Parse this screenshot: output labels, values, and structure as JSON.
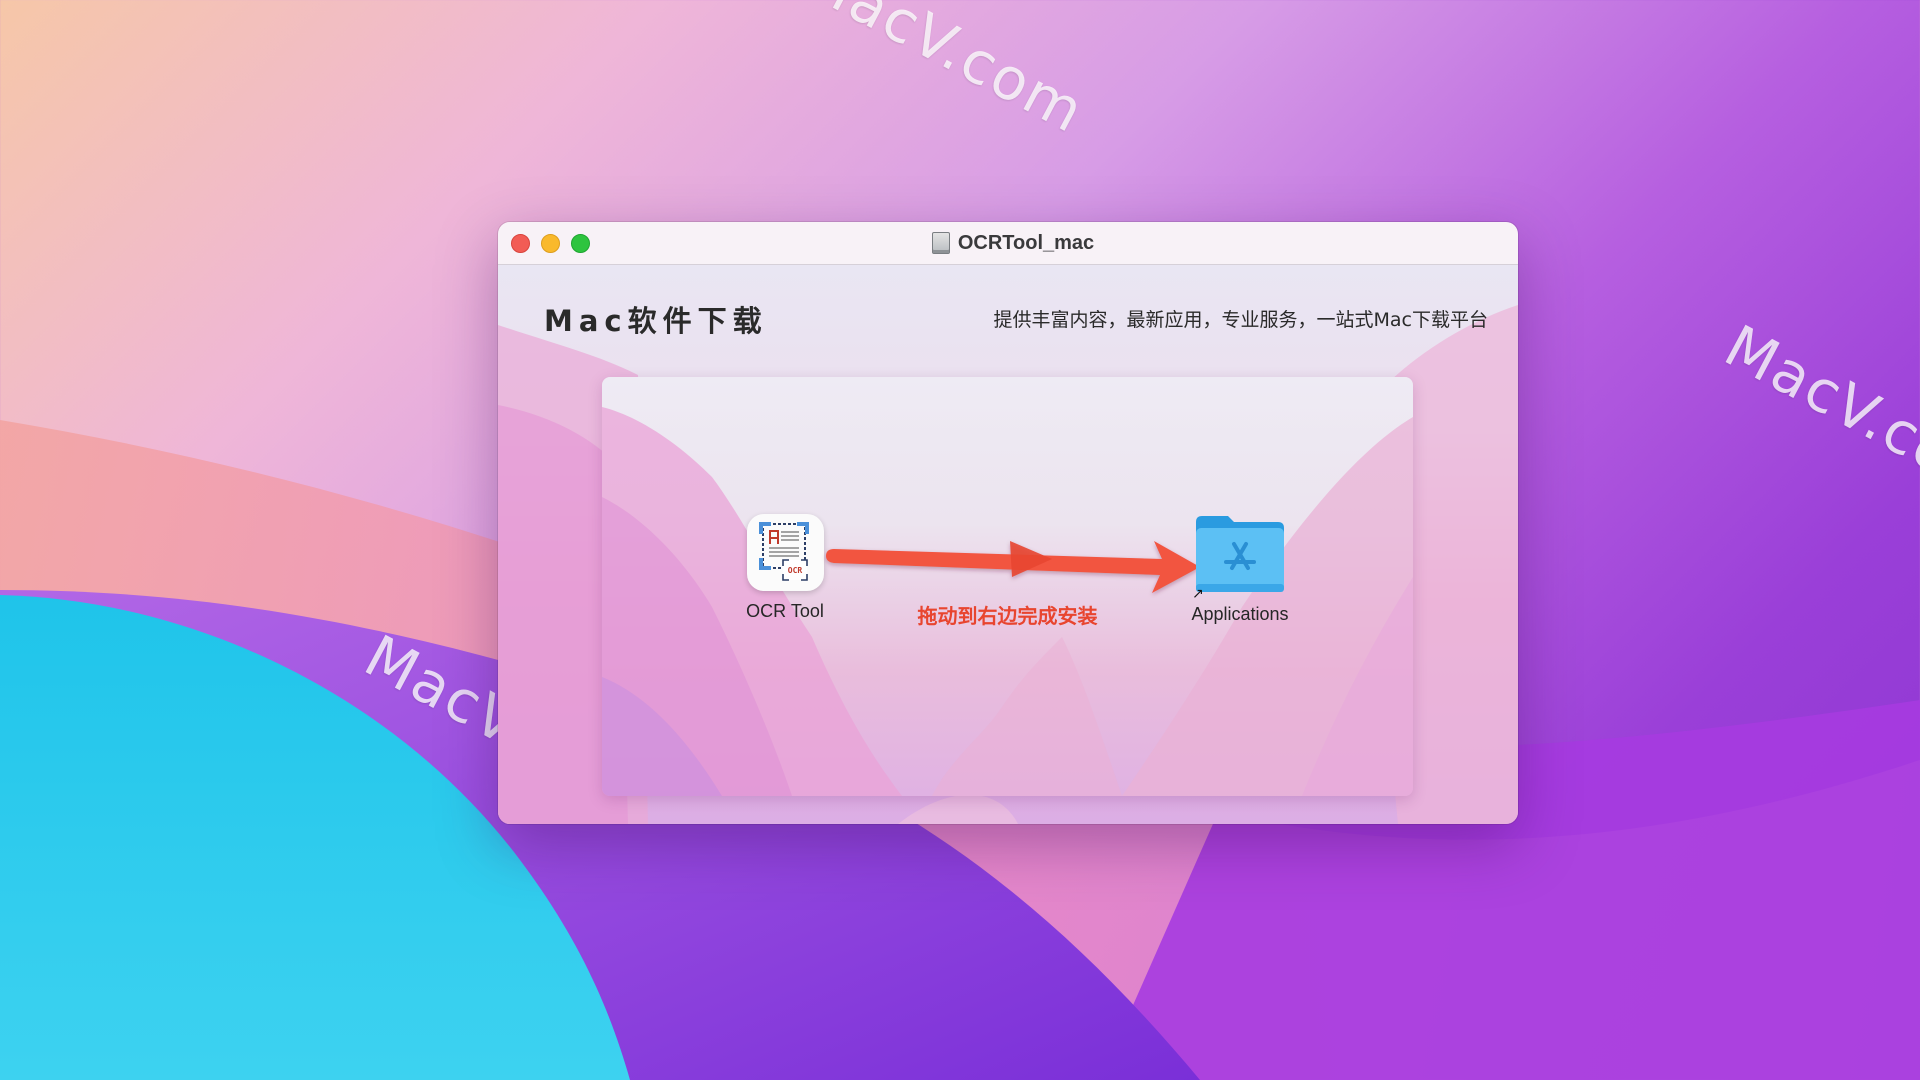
{
  "desktop": {
    "watermarks": [
      "MacV.com",
      "MacV.com",
      "MacV.com"
    ]
  },
  "window": {
    "title": "OCRTool_mac",
    "title_icon": "disk-image-icon",
    "controls": {
      "close": "close",
      "minimize": "minimize",
      "zoom": "zoom"
    }
  },
  "header": {
    "brand": "Mac软件下载",
    "tagline": "提供丰富内容，最新应用，专业服务，一站式Mac下载平台"
  },
  "installer": {
    "source": {
      "label": "OCR Tool",
      "icon": "ocr-tool-app-icon"
    },
    "target": {
      "label": "Applications",
      "icon": "applications-folder-icon"
    },
    "instruction": "拖动到右边完成安装",
    "instruction_color": "#e8452f"
  }
}
